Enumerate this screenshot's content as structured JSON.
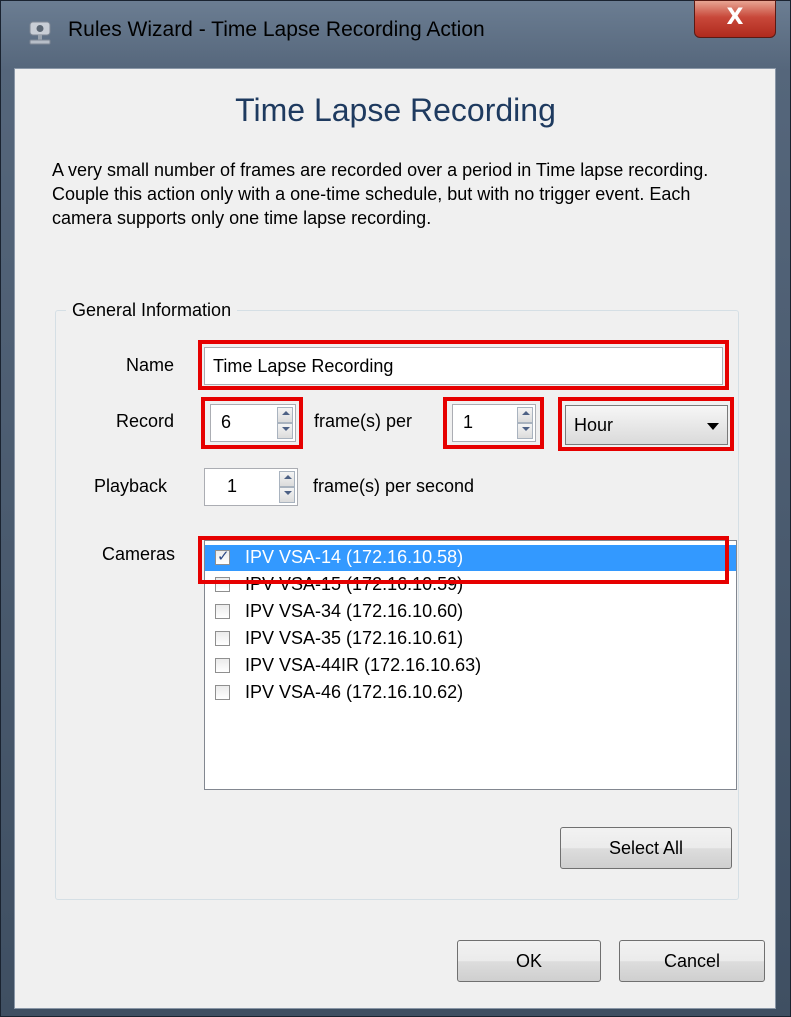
{
  "window": {
    "title": "Rules Wizard - Time Lapse Recording Action",
    "close_glyph": "X",
    "app_icon": "camera-icon"
  },
  "heading": "Time Lapse Recording",
  "description": "A very small number of frames are recorded over a period in Time lapse recording.  Couple this action only with a one-time schedule, but with no trigger event.  Each camera supports only one time lapse recording.",
  "group": {
    "title": "General Information",
    "name_label": "Name",
    "name_value": "Time Lapse Recording",
    "record_label": "Record",
    "record_frames": "6",
    "frames_per_label": "frame(s) per",
    "record_period": "1",
    "period_unit": "Hour",
    "playback_label": "Playback",
    "playback_frames": "1",
    "playback_suffix": "frame(s) per second",
    "cameras_label": "Cameras",
    "cameras": [
      {
        "label": "IPV VSA-14 (172.16.10.58)",
        "checked": true,
        "selected": true
      },
      {
        "label": "IPV VSA-15 (172.16.10.59)",
        "checked": false,
        "selected": false
      },
      {
        "label": "IPV VSA-34 (172.16.10.60)",
        "checked": false,
        "selected": false
      },
      {
        "label": "IPV VSA-35 (172.16.10.61)",
        "checked": false,
        "selected": false
      },
      {
        "label": "IPV VSA-44IR (172.16.10.63)",
        "checked": false,
        "selected": false
      },
      {
        "label": "IPV VSA-46 (172.16.10.62)",
        "checked": false,
        "selected": false
      }
    ],
    "select_all_label": "Select All"
  },
  "footer": {
    "ok_label": "OK",
    "cancel_label": "Cancel"
  },
  "colors": {
    "highlight": "#e60000",
    "selection": "#3399ff",
    "heading": "#1e3a5f"
  }
}
